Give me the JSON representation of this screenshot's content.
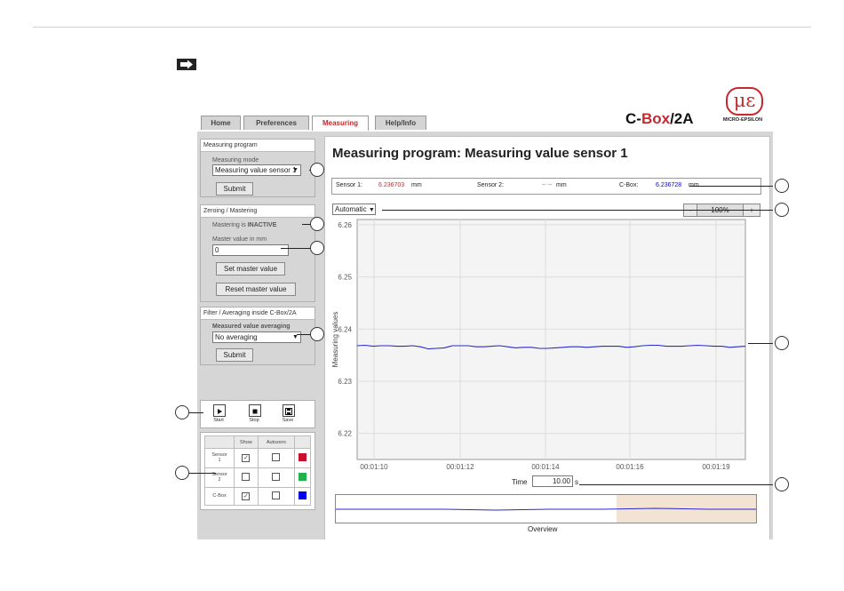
{
  "header": {
    "title_prefix": "C-",
    "title_highlight": "Box",
    "title_suffix": "/2A",
    "logo_symbol": "με",
    "logo_text": "MICRO-EPSILON"
  },
  "tabs": [
    {
      "label": "Home"
    },
    {
      "label": "Preferences"
    },
    {
      "label": "Measuring",
      "active": true
    },
    {
      "label": "Help/Info"
    }
  ],
  "sidebar": {
    "program": {
      "heading": "Measuring program",
      "mode_label": "Measuring mode",
      "mode_value": "Measuring value sensor 1",
      "submit": "Submit"
    },
    "zeroing": {
      "heading": "Zeroing / Mastering",
      "status_prefix": "Mastering is ",
      "status_value": "INACTIVE",
      "master_label": "Master value in mm",
      "master_value": "0",
      "set_button": "Set master value",
      "reset_button": "Reset master value"
    },
    "filter": {
      "heading": "Filter / Averaging inside C-Box/2A",
      "averaging_label": "Measured value averaging",
      "averaging_value": "No averaging",
      "submit": "Submit"
    },
    "controls": {
      "start": "Start",
      "stop": "Stop",
      "save": "Save"
    },
    "table": {
      "headers": [
        "",
        "Show",
        "Autozero",
        ""
      ],
      "rows": [
        {
          "name_line1": "Sensor",
          "name_line2": "1",
          "show": true,
          "autozero": false,
          "color": "#c8102e"
        },
        {
          "name_line1": "Sensor",
          "name_line2": "2",
          "show": false,
          "autozero": false,
          "color": "#22b14c"
        },
        {
          "name_line1": "C-Box",
          "name_line2": "",
          "show": true,
          "autozero": false,
          "color": "#0000ee"
        }
      ]
    }
  },
  "main": {
    "title": "Measuring program: Measuring value sensor 1",
    "readouts": {
      "s1_label": "Sensor 1:",
      "s1_value": "6.236703",
      "s1_unit": "mm",
      "s2_label": "Sensor 2:",
      "s2_value": "-- --",
      "s2_unit": "mm",
      "cb_label": "C-Box:",
      "cb_value": "6.236728",
      "cb_unit": "mm"
    },
    "scale_mode": "Automatic",
    "zoom": {
      "minus": "-",
      "value": "100%",
      "plus": "+"
    },
    "time_label": "Time",
    "time_value": "10.00",
    "time_unit": "s",
    "overview_label": "Overview"
  },
  "chart_data": {
    "type": "line",
    "ylabel": "Measuring values",
    "xlabel": "",
    "ylim": [
      6.215,
      6.261
    ],
    "yticks": [
      "6.26",
      "6.25",
      "6.24",
      "6.23",
      "6.22"
    ],
    "xticks": [
      "00:01:10",
      "00:01:12",
      "00:01:14",
      "00:01:16",
      "00:01:19"
    ],
    "series": [
      {
        "color": "#2a2acc",
        "values": [
          6.2368,
          6.2369,
          6.2367,
          6.2368,
          6.2368,
          6.2367,
          6.2367,
          6.2368,
          6.2366,
          6.2362,
          6.2363,
          6.2364,
          6.2368,
          6.2368,
          6.2368,
          6.2366,
          6.2366,
          6.2367,
          6.2368,
          6.2366,
          6.2364,
          6.2365,
          6.2365,
          6.2363,
          6.2363,
          6.2364,
          6.2365,
          6.2366,
          6.2366,
          6.2365,
          6.2366,
          6.2367,
          6.2367,
          6.2367,
          6.2365,
          6.2366,
          6.2368,
          6.2369,
          6.2369,
          6.2367,
          6.2367,
          6.2367,
          6.2368,
          6.2369,
          6.2368,
          6.2367,
          6.2367,
          6.2365,
          6.2366,
          6.2367
        ]
      }
    ],
    "grid": true
  }
}
